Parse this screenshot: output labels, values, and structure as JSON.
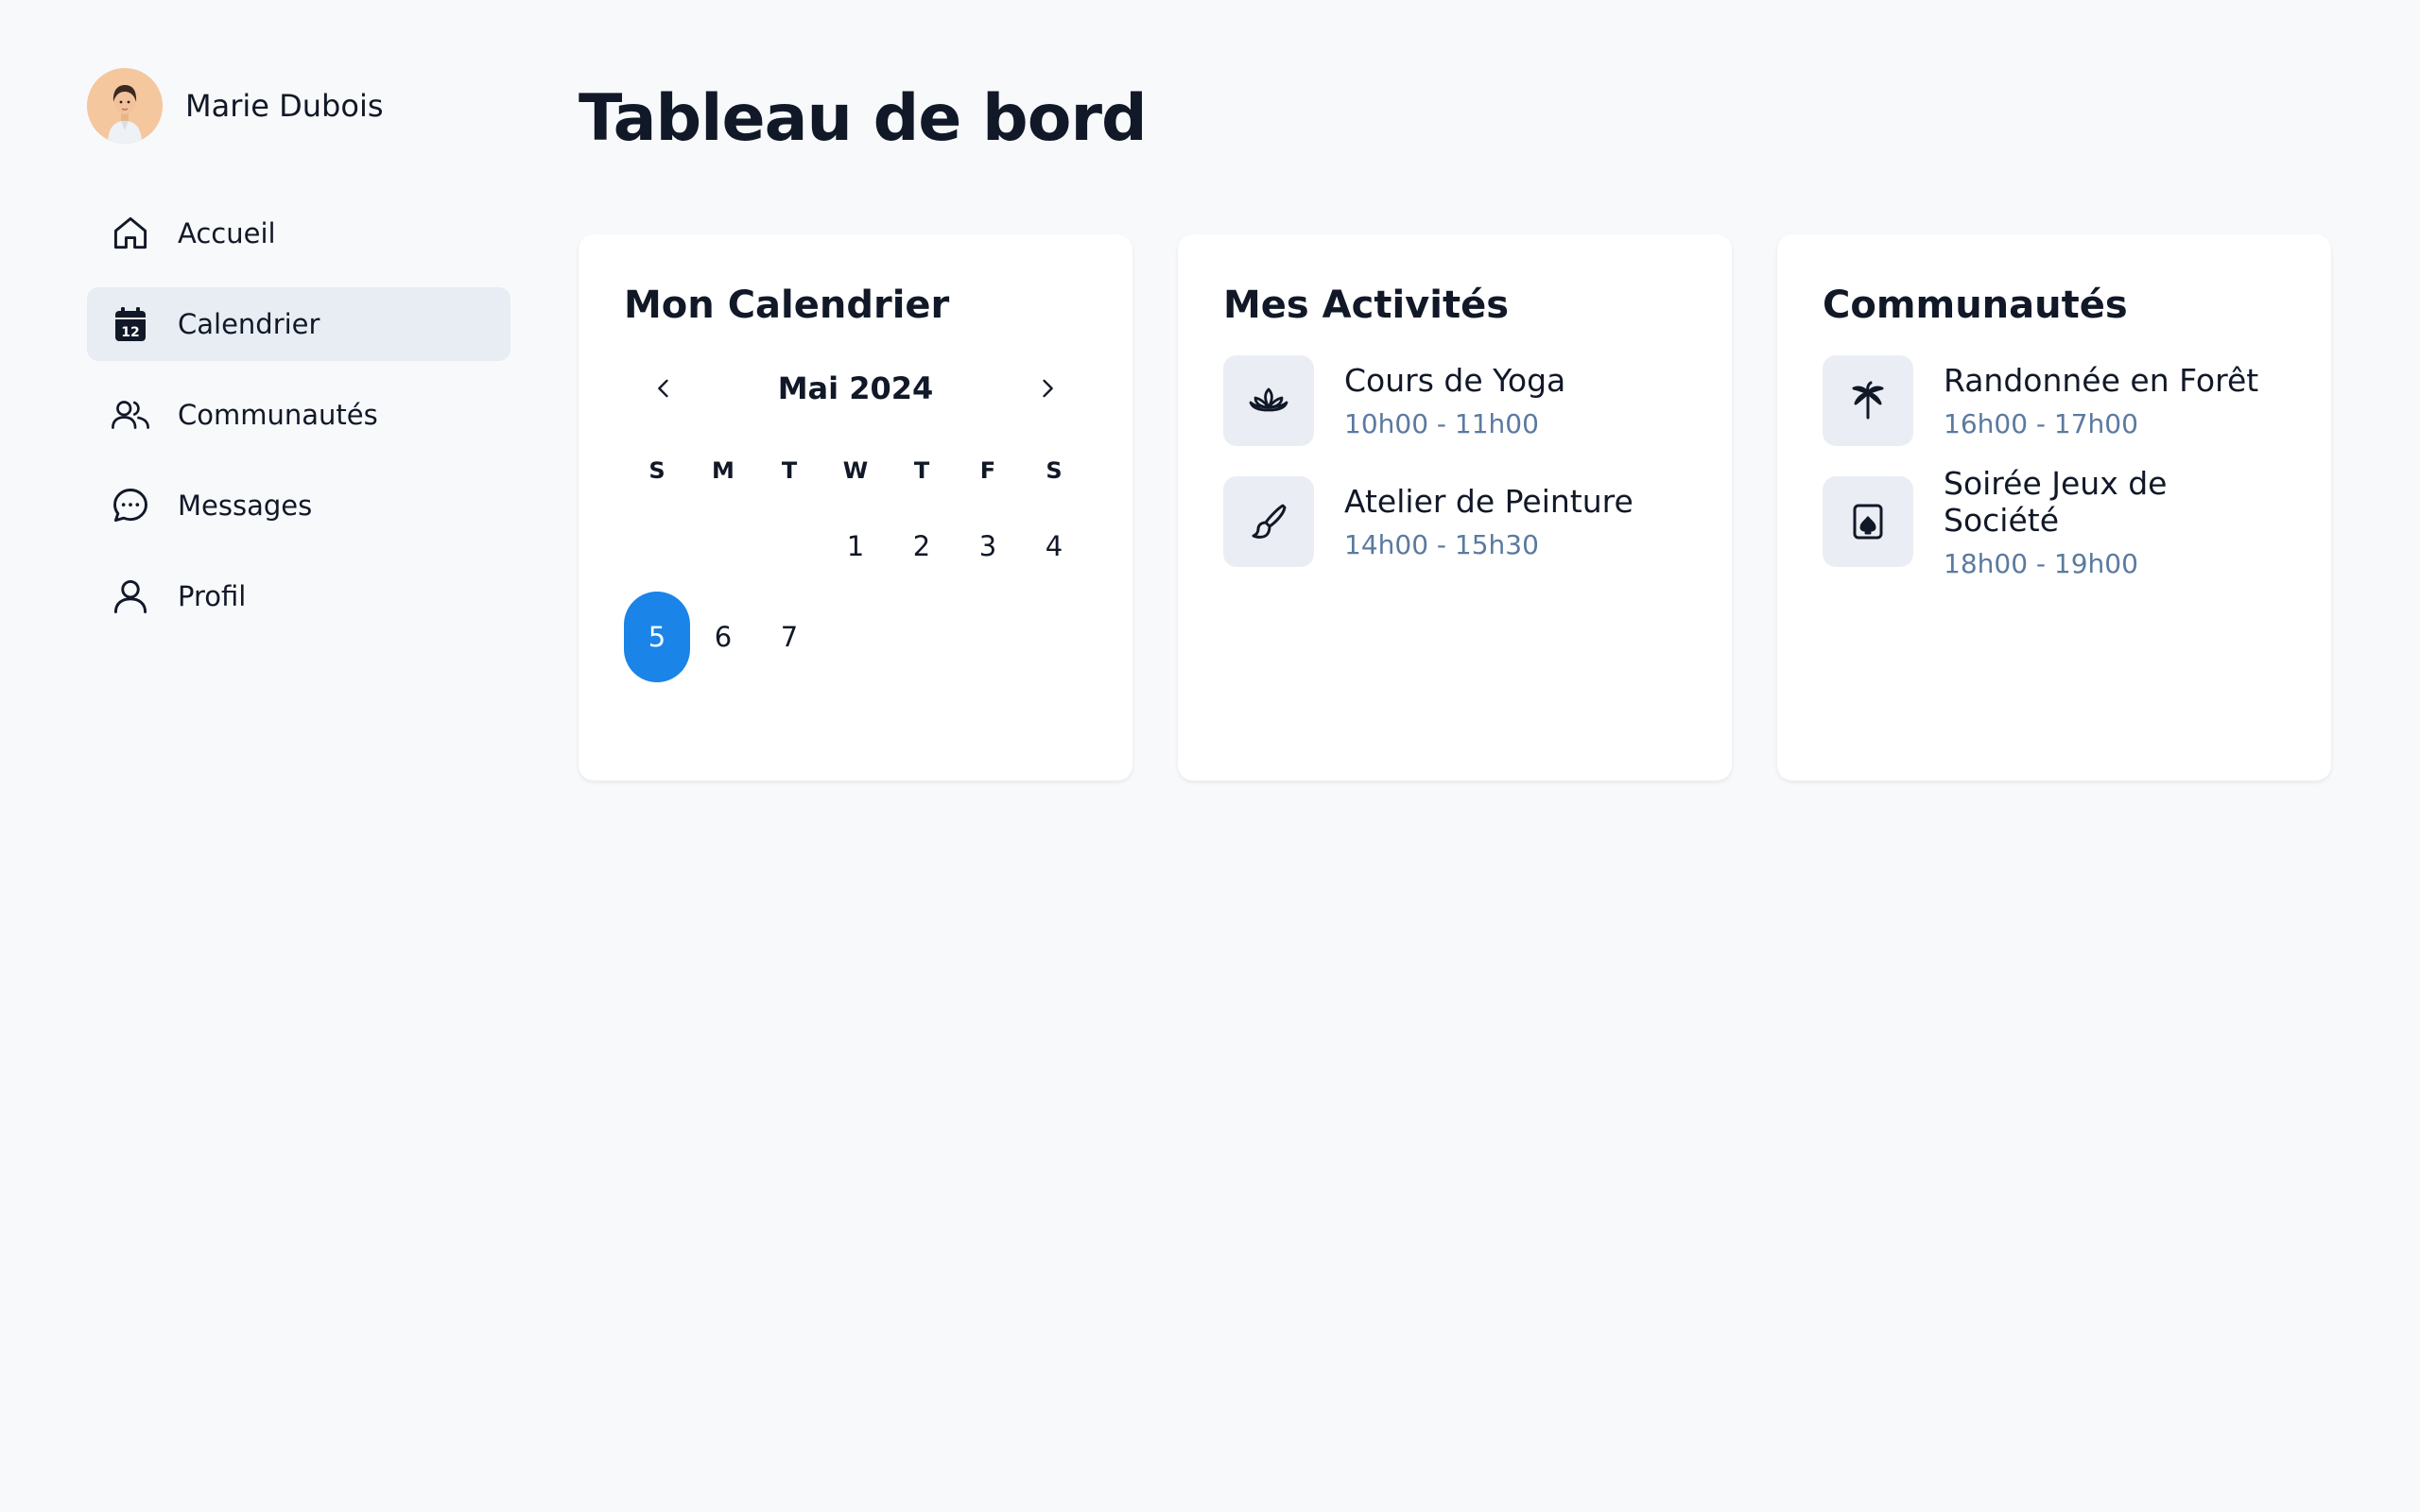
{
  "user": {
    "name": "Marie Dubois"
  },
  "nav": [
    {
      "label": "Accueil",
      "icon": "home-icon"
    },
    {
      "label": "Calendrier",
      "icon": "calendar-icon",
      "active": true,
      "badge": "12"
    },
    {
      "label": "Communautés",
      "icon": "users-icon"
    },
    {
      "label": "Messages",
      "icon": "chat-icon"
    },
    {
      "label": "Profil",
      "icon": "person-icon"
    }
  ],
  "page": {
    "title": "Tableau de bord"
  },
  "calendar": {
    "title": "Mon Calendrier",
    "month": "Mai 2024",
    "weekdays": [
      "S",
      "M",
      "T",
      "W",
      "T",
      "F",
      "S"
    ],
    "days": [
      "1",
      "2",
      "3",
      "4",
      "5",
      "6",
      "7"
    ],
    "selected_day": "5"
  },
  "activities": {
    "title": "Mes Activités",
    "items": [
      {
        "name": "Cours de Yoga",
        "time": "10h00 - 11h00",
        "icon": "lotus-icon"
      },
      {
        "name": "Atelier de Peinture",
        "time": "14h00 - 15h30",
        "icon": "paintbrush-icon"
      }
    ]
  },
  "communities": {
    "title": "Communautés",
    "items": [
      {
        "name": "Randonnée en Forêt",
        "time": "16h00 - 17h00",
        "icon": "palm-tree-icon"
      },
      {
        "name": "Soirée Jeux de Société",
        "time": "18h00 - 19h00",
        "icon": "card-game-icon"
      }
    ]
  },
  "colors": {
    "accent": "#1a84e8",
    "muted_text": "#5b7aa0",
    "active_nav_bg": "#e8edf4",
    "icon_tile_bg": "#eaeef4"
  }
}
